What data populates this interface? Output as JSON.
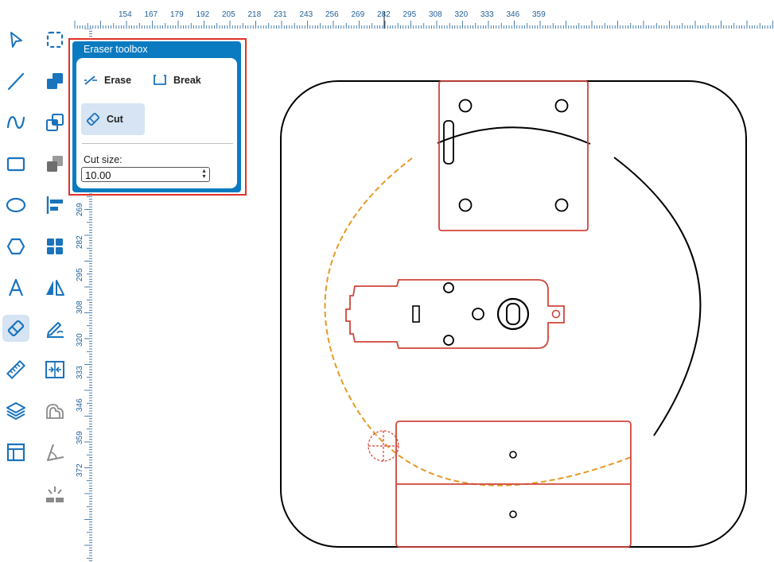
{
  "toolbar": {
    "col1": [
      {
        "icon": "select-arrow-icon"
      },
      {
        "icon": "line-icon"
      },
      {
        "icon": "curve-icon"
      },
      {
        "icon": "rectangle-icon"
      },
      {
        "icon": "ellipse-icon"
      },
      {
        "icon": "polygon-icon"
      },
      {
        "icon": "text-icon"
      },
      {
        "icon": "eraser-icon",
        "active": true
      },
      {
        "icon": "ruler-icon"
      },
      {
        "icon": "layers-icon"
      },
      {
        "icon": "layout-icon"
      }
    ],
    "col2": [
      {
        "icon": "dashed-rect-icon"
      },
      {
        "icon": "union-icon"
      },
      {
        "icon": "intersect-icon"
      },
      {
        "icon": "subtract-icon"
      },
      {
        "icon": "align-left-icon"
      },
      {
        "icon": "grid-icon"
      },
      {
        "icon": "mirror-icon"
      },
      {
        "icon": "edit-path-icon"
      },
      {
        "icon": "distribute-icon"
      },
      {
        "icon": "offset-icon"
      },
      {
        "icon": "angle-icon"
      },
      {
        "icon": "light-icon"
      }
    ]
  },
  "ruler": {
    "unit": "mm",
    "top_labels": [
      "154",
      "167",
      "179",
      "192",
      "205",
      "218",
      "231",
      "243",
      "256",
      "269",
      "282",
      "295",
      "308",
      "320",
      "333",
      "346",
      "359"
    ],
    "left_labels": [
      "269",
      "282",
      "295",
      "308",
      "320",
      "333",
      "346",
      "359",
      "372"
    ]
  },
  "eraser_panel": {
    "title": "Eraser toolbox",
    "erase_label": "Erase",
    "break_label": "Break",
    "cut_label": "Cut",
    "cut_size_label": "Cut size:",
    "cut_size_value": "10.00"
  },
  "colors": {
    "accent": "#0a7bc1",
    "selection_red": "#e03226",
    "part_red": "#d0453a",
    "dash_orange": "#e59a25",
    "icon_blue": "#1a73bd"
  }
}
